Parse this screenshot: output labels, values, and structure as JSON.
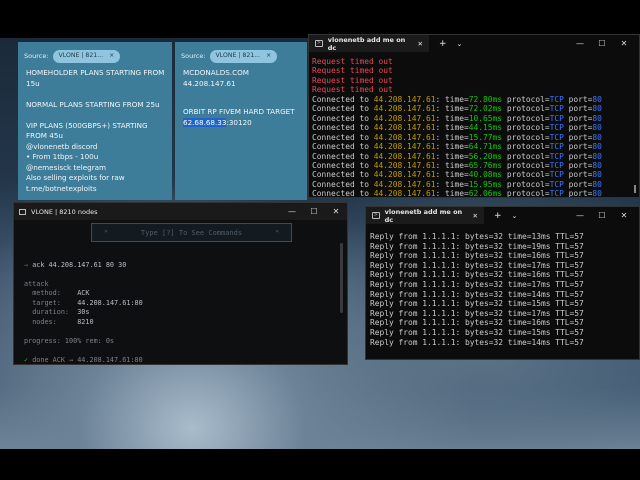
{
  "widget1": {
    "source_label": "Source:",
    "source_value": "VLONE | 821...",
    "lines": [
      "HOMEHOLDER PLANS STARTING FROM 15u",
      "",
      "NORMAL PLANS STARTING FROM 25u",
      "",
      "VIP PLANS (500GBPS+) STARTING FROM 45u",
      "@vlonenetb discord",
      "• From 1tbps - 100u",
      "@nemesisck telegram",
      "Also selling exploits for raw",
      "t.me/botnetexploits"
    ]
  },
  "widget2": {
    "source_label": "Source:",
    "source_value": "VLONE | 821...",
    "line1": "MCDONALDS.COM",
    "line2": "44.208.147.61",
    "line3": "ORBIT RP FIVEM HARD TARGET",
    "ip_highlight": "62.68.68.33",
    "port": ":30120"
  },
  "ping_window": {
    "tab_title": "vlonenetb add me on dc",
    "timeouts": [
      "Request timed out",
      "Request timed out",
      "Request timed out",
      "Request timed out"
    ],
    "connected_prefix": "Connected to ",
    "ip": "44.208.147.61",
    "times": [
      "72.80ms",
      "72.02ms",
      "10.65ms",
      "44.15ms",
      "15.77ms",
      "64.71ms",
      "56.20ms",
      "65.76ms",
      "40.08ms",
      "15.95ms",
      "62.06ms"
    ],
    "protocol": "TCP",
    "port": "80"
  },
  "reply_window": {
    "tab_title": "vlonenetb add me on dc",
    "rows": [
      "Reply from 1.1.1.1: bytes=32 time=13ms TTL=57",
      "Reply from 1.1.1.1: bytes=32 time=19ms TTL=57",
      "Reply from 1.1.1.1: bytes=32 time=16ms TTL=57",
      "Reply from 1.1.1.1: bytes=32 time=17ms TTL=57",
      "Reply from 1.1.1.1: bytes=32 time=16ms TTL=57",
      "Reply from 1.1.1.1: bytes=32 time=17ms TTL=57",
      "Reply from 1.1.1.1: bytes=32 time=14ms TTL=57",
      "Reply from 1.1.1.1: bytes=32 time=15ms TTL=57",
      "Reply from 1.1.1.1: bytes=32 time=17ms TTL=57",
      "Reply from 1.1.1.1: bytes=32 time=16ms TTL=57",
      "Reply from 1.1.1.1: bytes=32 time=15ms TTL=57",
      "Reply from 1.1.1.1: bytes=32 time=14ms TTL=57"
    ]
  },
  "nodes_window": {
    "title": "VLONE | 8210 nodes",
    "hint": "Type [?] To See Commands",
    "command": "ack 44.208.147.61 80 30",
    "attack_header": "attack",
    "method_label": "method:",
    "method_value": "ACK",
    "target_label": "target:",
    "target_value": "44.208.147.61:80",
    "duration_label": "duration:",
    "duration_value": "30s",
    "nodes_label": "nodes:",
    "nodes_value": "8210",
    "progress": "progress: 100% rem: 0s",
    "done": "done ACK → 44.208.147.61:80"
  },
  "colors": {
    "widget_bg": "#3d7d9a",
    "terminal_bg": "#0c0c0c",
    "timeout_red": "#e74856",
    "ip_yellow": "#c19c00",
    "time_green": "#16c60c",
    "protocol_blue": "#3b78ff"
  }
}
